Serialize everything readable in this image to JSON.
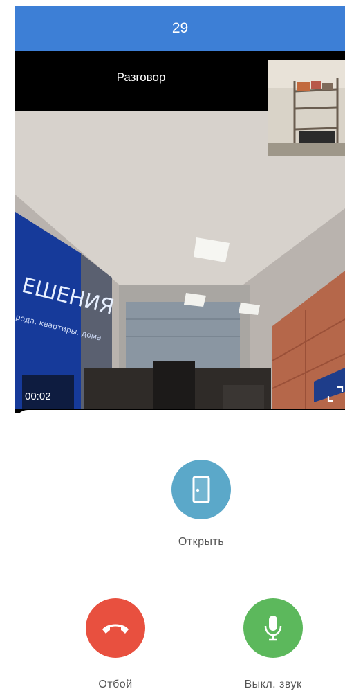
{
  "header": {
    "title": "29"
  },
  "call": {
    "status": "Разговор",
    "timer": "00:02"
  },
  "actions": {
    "open": {
      "label": "Открыть",
      "icon": "door-icon",
      "color": "#5ba8c9"
    },
    "hangup": {
      "label": "Отбой",
      "icon": "phone-hangup-icon",
      "color": "#e8503f"
    },
    "mute": {
      "label": "Выкл. звук",
      "icon": "microphone-icon",
      "color": "#5cb85c"
    }
  },
  "colors": {
    "header": "#3d7fd6",
    "video_background": "#000000"
  },
  "video": {
    "banner_text": "ЕШЕНИЯ",
    "banner_subtext": "рода, квартиры, дома"
  }
}
